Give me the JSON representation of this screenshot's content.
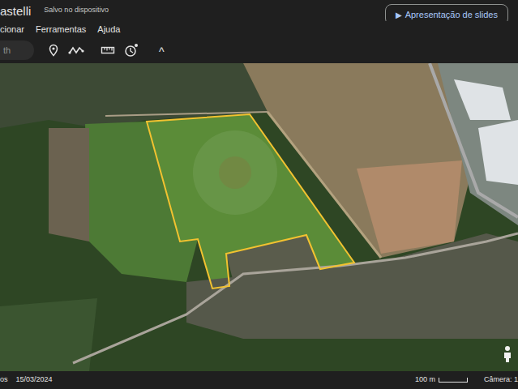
{
  "window": {
    "title": "astelli",
    "save_status": "Salvo no dispositivo"
  },
  "slides_button": {
    "icon": "▶",
    "label": "Apresentação de slides"
  },
  "menu": [
    "cionar",
    "Ferramentas",
    "Ajuda"
  ],
  "search": {
    "value": "th"
  },
  "toolbar": {
    "collapse": "^"
  },
  "status_bar": {
    "data_label": "os",
    "date": "15/03/2024",
    "scale": "100 m",
    "camera": "Câmera: 1"
  }
}
